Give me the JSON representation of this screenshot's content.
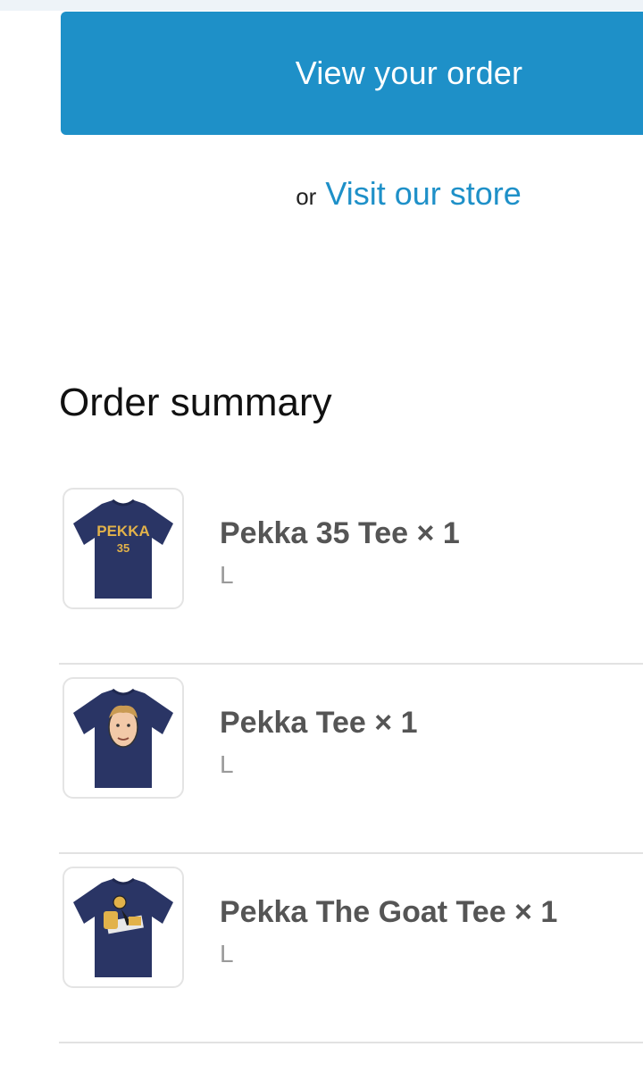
{
  "actions": {
    "view_order_label": "View your order",
    "or_label": "or",
    "visit_store_label": "Visit our store"
  },
  "colors": {
    "accent": "#1e90c8",
    "shirt": "#2a3565",
    "print_gold": "#e2b24a"
  },
  "order_summary": {
    "title": "Order summary",
    "items": [
      {
        "title": "Pekka 35 Tee × 1",
        "variant": "L",
        "thumbnail_icon": "tshirt-pekka-35-icon",
        "print_text": "PEKKA",
        "print_number": "35"
      },
      {
        "title": "Pekka Tee × 1",
        "variant": "L",
        "thumbnail_icon": "tshirt-face-icon"
      },
      {
        "title": "Pekka The Goat Tee × 1",
        "variant": "L",
        "thumbnail_icon": "tshirt-goat-icon"
      }
    ]
  }
}
